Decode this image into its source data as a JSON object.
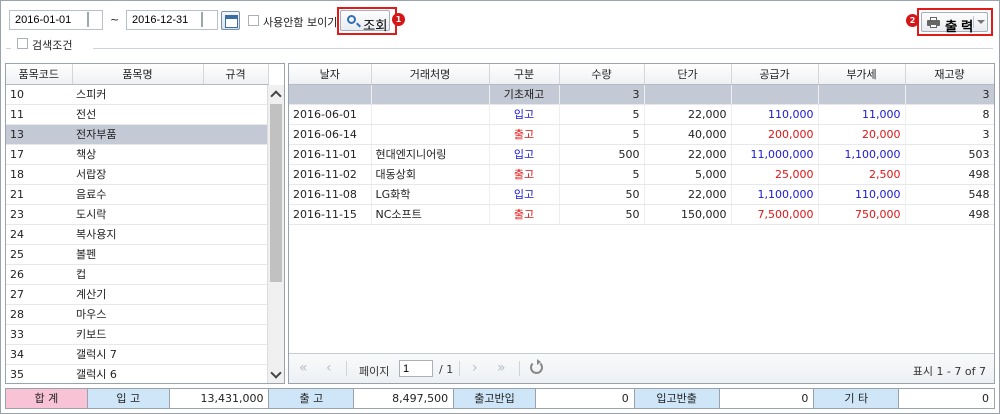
{
  "toolbar": {
    "date_from": "2016-01-01",
    "date_to": "2016-12-31",
    "tilde": "~",
    "show_unused_label": "사용안함 보이기",
    "search_label": "조회",
    "print_label": "출 력",
    "badge_1": "1",
    "badge_2": "2",
    "search_condition_label": "검색조건"
  },
  "left_table": {
    "headers": [
      "품목코드",
      "품목명",
      "규격"
    ],
    "rows": [
      {
        "code": "10",
        "name": "스피커",
        "spec": ""
      },
      {
        "code": "11",
        "name": "전선",
        "spec": ""
      },
      {
        "code": "13",
        "name": "전자부품",
        "spec": "",
        "selected": true
      },
      {
        "code": "17",
        "name": "책상",
        "spec": ""
      },
      {
        "code": "18",
        "name": "서랍장",
        "spec": ""
      },
      {
        "code": "21",
        "name": "음료수",
        "spec": ""
      },
      {
        "code": "23",
        "name": "도시락",
        "spec": ""
      },
      {
        "code": "24",
        "name": "복사용지",
        "spec": ""
      },
      {
        "code": "25",
        "name": "볼펜",
        "spec": ""
      },
      {
        "code": "26",
        "name": "컵",
        "spec": ""
      },
      {
        "code": "27",
        "name": "계산기",
        "spec": ""
      },
      {
        "code": "28",
        "name": "마우스",
        "spec": ""
      },
      {
        "code": "33",
        "name": "키보드",
        "spec": ""
      },
      {
        "code": "34",
        "name": "갤럭시 7",
        "spec": ""
      },
      {
        "code": "35",
        "name": "갤럭시 6",
        "spec": ""
      }
    ]
  },
  "right_table": {
    "headers": [
      "날자",
      "거래처명",
      "구분",
      "수량",
      "단가",
      "공급가",
      "부가세",
      "재고량"
    ],
    "opening": {
      "label": "기초재고",
      "qty": "3",
      "stock": "3"
    },
    "rows": [
      {
        "date": "2016-06-01",
        "vendor": "",
        "type": "입고",
        "kind": "in",
        "qty": "5",
        "price": "22,000",
        "supply": "110,000",
        "vat": "11,000",
        "stock": "8"
      },
      {
        "date": "2016-06-14",
        "vendor": "",
        "type": "출고",
        "kind": "out",
        "qty": "5",
        "price": "40,000",
        "supply": "200,000",
        "vat": "20,000",
        "stock": "3"
      },
      {
        "date": "2016-11-01",
        "vendor": "현대엔지니어링",
        "type": "입고",
        "kind": "in",
        "qty": "500",
        "price": "22,000",
        "supply": "11,000,000",
        "vat": "1,100,000",
        "stock": "503"
      },
      {
        "date": "2016-11-02",
        "vendor": "대동상회",
        "type": "출고",
        "kind": "out",
        "qty": "5",
        "price": "5,000",
        "supply": "25,000",
        "vat": "2,500",
        "stock": "498"
      },
      {
        "date": "2016-11-08",
        "vendor": "LG화학",
        "type": "입고",
        "kind": "in",
        "qty": "50",
        "price": "22,000",
        "supply": "1,100,000",
        "vat": "110,000",
        "stock": "548"
      },
      {
        "date": "2016-11-15",
        "vendor": "NC소프트",
        "type": "출고",
        "kind": "out",
        "qty": "50",
        "price": "150,000",
        "supply": "7,500,000",
        "vat": "750,000",
        "stock": "498"
      }
    ]
  },
  "pager": {
    "page_label": "페이지",
    "page_value": "1",
    "total_pages": "/ 1",
    "display_info": "표시 1 - 7 of 7"
  },
  "summary": {
    "total_label": "합 계",
    "in_label": "입 고",
    "in_value": "13,431,000",
    "out_label": "출 고",
    "out_value": "8,497,500",
    "out_return_label": "출고반입",
    "out_return_value": "0",
    "in_return_label": "입고반출",
    "in_return_value": "0",
    "etc_label": "기 타",
    "etc_value": "0"
  },
  "colors": {
    "in": "#1a1ad6",
    "out": "#e01515",
    "selected_row": "#c3c9d5",
    "highlight_box": "#e01b1b"
  }
}
